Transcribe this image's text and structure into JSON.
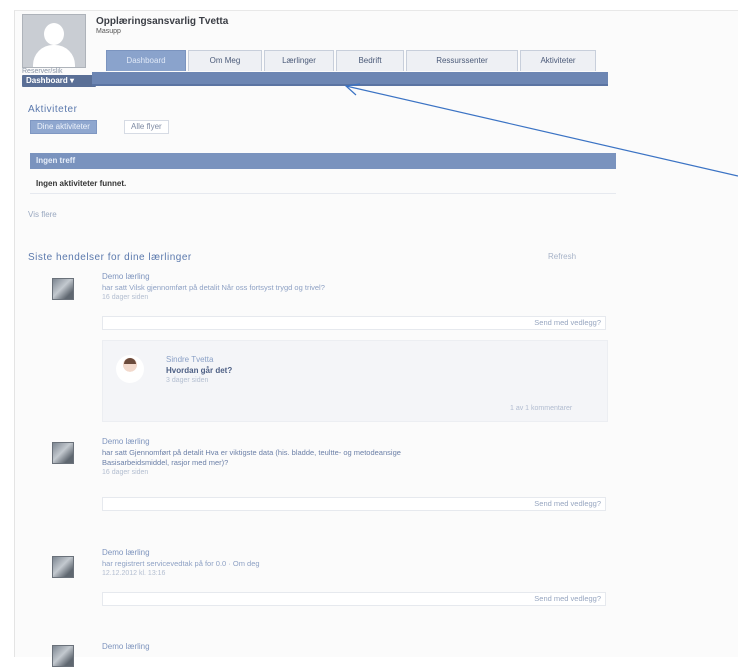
{
  "profile": {
    "name": "Opplæringsansvarlig Tvetta",
    "subtitle": "Masupp",
    "dashboard_label": "Dashboard",
    "dashboard_small": "Reserver/slik"
  },
  "tabs": [
    {
      "label": "Dashboard",
      "active": true
    },
    {
      "label": "Om Meg",
      "active": false
    },
    {
      "label": "Lærlinger",
      "active": false
    },
    {
      "label": "Bedrift",
      "active": false
    },
    {
      "label": "Ressurssenter",
      "active": false
    },
    {
      "label": "Aktiviteter",
      "active": false
    }
  ],
  "activities": {
    "title": "Aktiviteter",
    "filters": [
      "Dine aktiviteter",
      "Alle flyer"
    ],
    "table_header": "Ingen treff",
    "empty_text": "Ingen aktiviteter funnet.",
    "see_more": "Vis flere"
  },
  "events": {
    "title": "Siste hendelser for dine lærlinger",
    "refresh": "Refresh",
    "items": [
      {
        "name": "Demo lærling",
        "text": "har satt Vilsk gjennomført på detalit Når oss fortsyst trygd og trivel?",
        "time": "16 dager siden",
        "reply": "Send med vedlegg?"
      },
      {
        "name": "Demo lærling",
        "text": "har satt Gjennomført på detalit Hva er viktigste data (his. bladde, teultte- og metodeansige",
        "text2": "Basisarbeidsmiddel, rasjor med mer)?",
        "time": "16 dager siden",
        "reply": "Send med vedlegg?"
      },
      {
        "name": "Demo lærling",
        "text": "har registrert servicevedtak på for 0.0 · Om deg",
        "time": "12.12.2012 kl. 13:16",
        "reply": "Send med vedlegg?"
      },
      {
        "name": "Demo lærling"
      }
    ],
    "comment": {
      "name": "Sindre Tvetta",
      "text": "Hvordan går det?",
      "time": "3 dager siden",
      "count": "1 av 1 kommentarer"
    }
  }
}
